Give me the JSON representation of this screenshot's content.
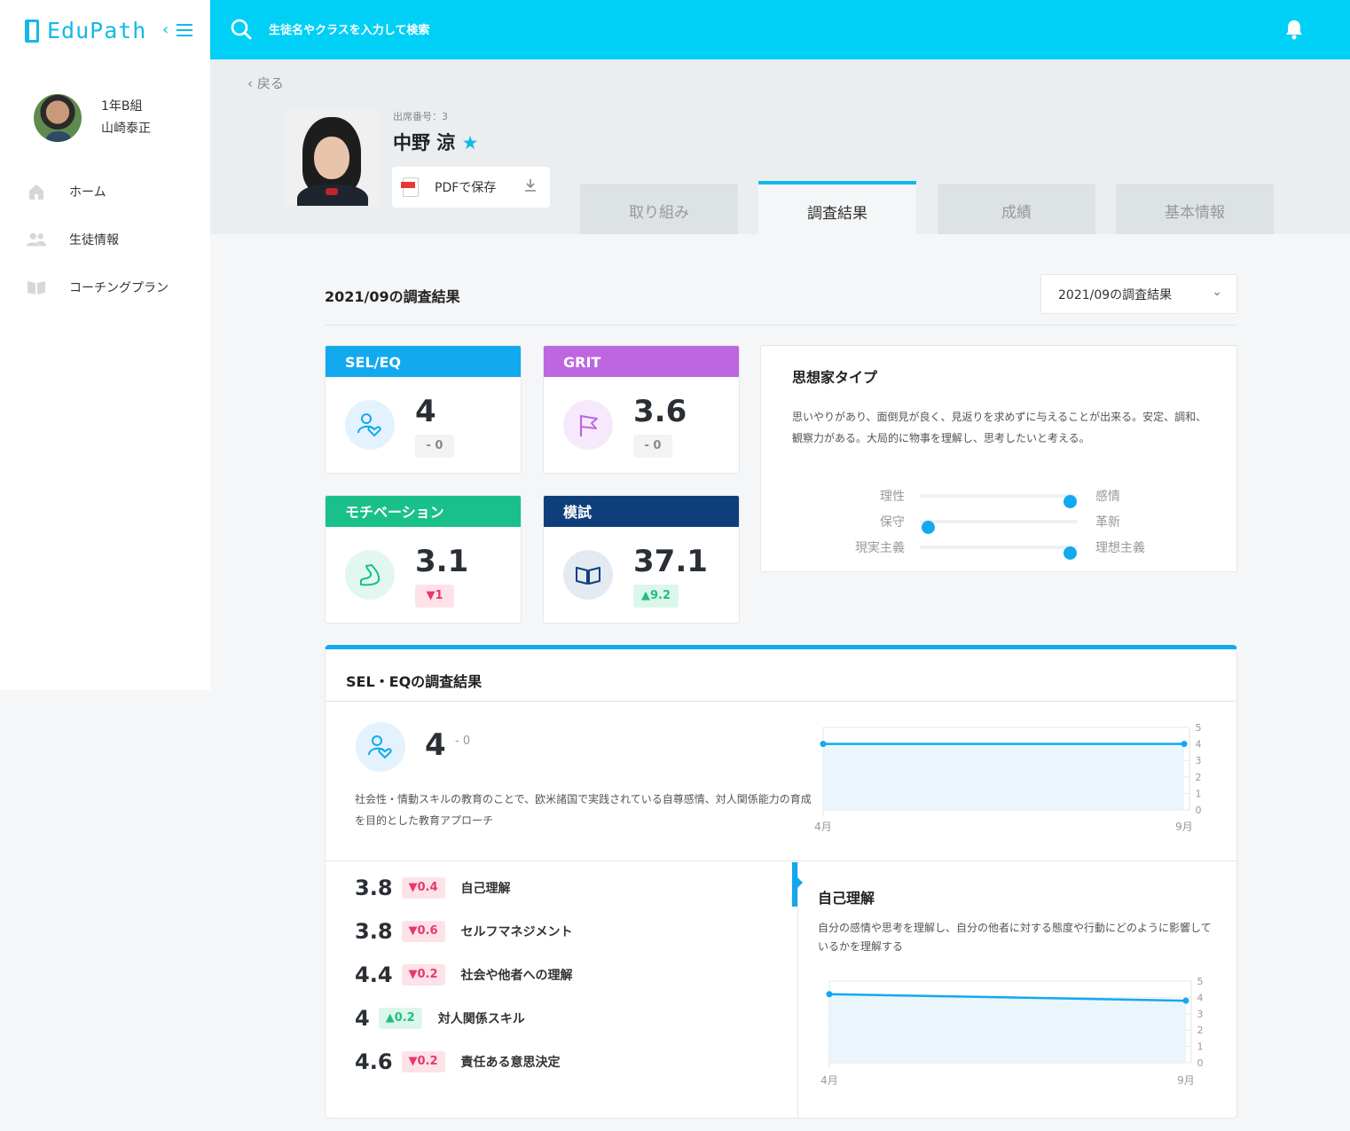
{
  "app": {
    "logo_text": "EduPath"
  },
  "search": {
    "placeholder": "生徒名やクラスを入力して検索"
  },
  "teacher": {
    "class_name": "1年B組",
    "name": "山崎泰正"
  },
  "sidebar": {
    "items": [
      {
        "label": "ホーム",
        "icon": "home-icon"
      },
      {
        "label": "生徒情報",
        "icon": "users-icon"
      },
      {
        "label": "コーチングプラン",
        "icon": "book-icon"
      }
    ]
  },
  "header": {
    "back_label": "戻る",
    "attendance_label": "出席番号：3",
    "student_name": "中野 涼",
    "favorite_star": "★",
    "pdf_label": "PDFで保存"
  },
  "tabs": [
    {
      "label": "取り組み",
      "active": false
    },
    {
      "label": "調査結果",
      "active": true
    },
    {
      "label": "成績",
      "active": false
    },
    {
      "label": "基本情報",
      "active": false
    }
  ],
  "results": {
    "title": "2021/09の調査結果",
    "period_select": "2021/09の調査結果"
  },
  "metrics": [
    {
      "title": "SEL/EQ",
      "value": "4",
      "delta": "- 0",
      "trend": "neutral",
      "color": "#12a9ee",
      "icon": "people-heart-icon"
    },
    {
      "title": "GRIT",
      "value": "3.6",
      "delta": "- 0",
      "trend": "neutral",
      "color": "#bd66e0",
      "icon": "flag-icon"
    },
    {
      "title": "モチベーション",
      "value": "3.1",
      "delta": "▼1",
      "trend": "down",
      "color": "#19c08a",
      "icon": "muscle-icon"
    },
    {
      "title": "模試",
      "value": "37.1",
      "delta": "▲9.2",
      "trend": "up",
      "color": "#0e3f7a",
      "icon": "open-book-icon"
    }
  ],
  "thinker": {
    "title": "思想家タイプ",
    "description": "思いやりがあり、面倒見が良く、見返りを求めずに与えることが出来る。安定、調和、観察力がある。大局的に物事を理解し、思考したいと考える。",
    "traits": [
      {
        "left": "理性",
        "right": "感情",
        "level": 0.95
      },
      {
        "left": "保守",
        "right": "革新",
        "level": 0.05
      },
      {
        "left": "現実主義",
        "right": "理想主義",
        "level": 0.95
      }
    ]
  },
  "sel": {
    "title": "SEL・EQの調査結果",
    "score": "4",
    "score_delta": "- 0",
    "description": "社会性・情動スキルの教育のことで、欧米諸国で実践されている自尊感情、対人関係能力の育成を目的とした教育アプローチ",
    "skills": [
      {
        "value": "3.8",
        "delta": "▼0.4",
        "trend": "down",
        "name": "自己理解"
      },
      {
        "value": "3.8",
        "delta": "▼0.6",
        "trend": "down",
        "name": "セルフマネジメント"
      },
      {
        "value": "4.4",
        "delta": "▼0.2",
        "trend": "down",
        "name": "社会や他者への理解"
      },
      {
        "value": "4",
        "delta": "▲0.2",
        "trend": "up",
        "name": "対人関係スキル"
      },
      {
        "value": "4.6",
        "delta": "▼0.2",
        "trend": "down",
        "name": "責任ある意思決定"
      }
    ],
    "detail": {
      "title": "自己理解",
      "description": "自分の感情や思考を理解し、自分の他者に対する態度や行動にどのように影響しているかを理解する"
    }
  },
  "chart_data": [
    {
      "type": "area",
      "x": [
        "4月",
        "9月"
      ],
      "series": [
        {
          "values": [
            4,
            4
          ]
        }
      ],
      "ylim": [
        0,
        5
      ],
      "yticks": [
        "0",
        "1",
        "2",
        "3",
        "4",
        "5"
      ],
      "color": "#12a9ee"
    },
    {
      "type": "area",
      "x": [
        "4月",
        "9月"
      ],
      "series": [
        {
          "values": [
            4.2,
            3.8
          ]
        }
      ],
      "ylim": [
        0,
        5
      ],
      "yticks": [
        "0",
        "1",
        "2",
        "3",
        "4",
        "5"
      ],
      "color": "#12a9ee"
    }
  ]
}
